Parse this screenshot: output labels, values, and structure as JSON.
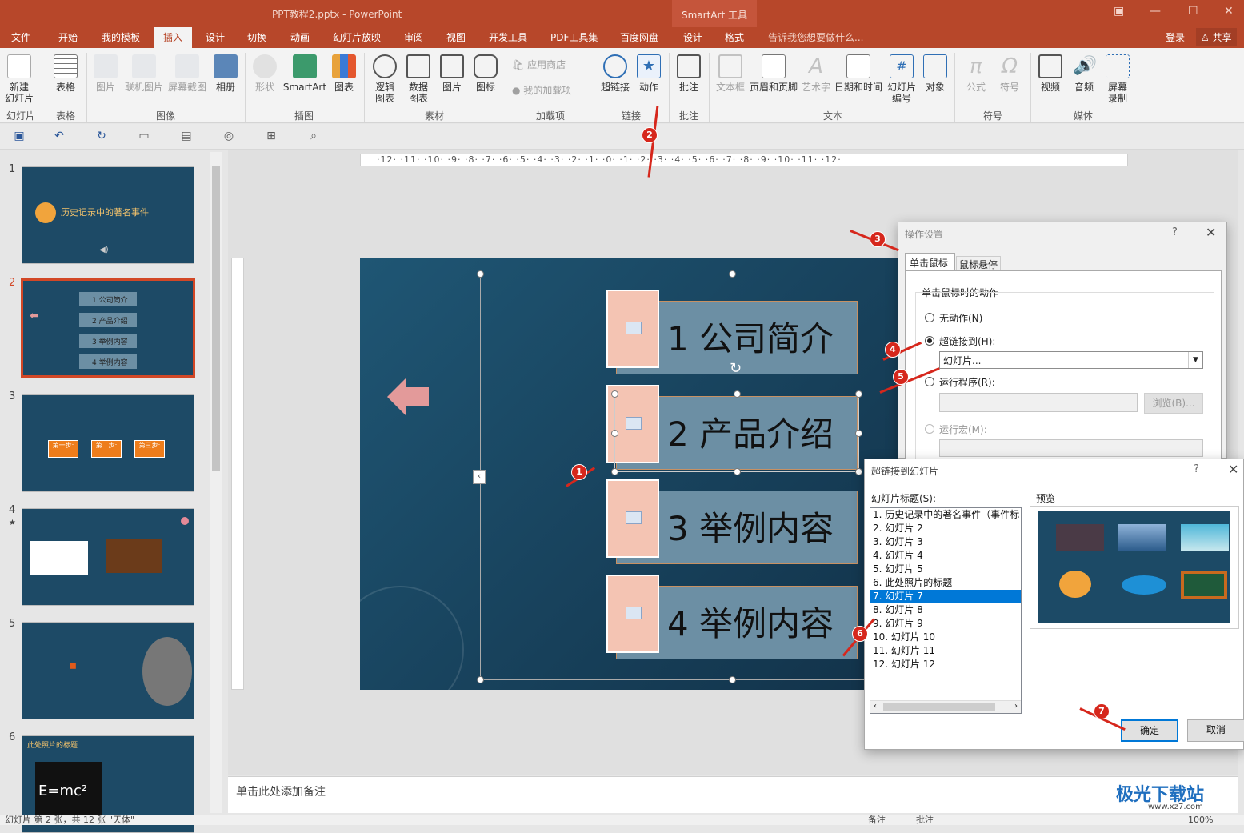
{
  "window": {
    "title": "PPT教程2.pptx - PowerPoint",
    "context_tab": "SmartArt 工具"
  },
  "tabs": [
    "文件",
    "开始",
    "我的模板",
    "插入",
    "设计",
    "切换",
    "动画",
    "幻灯片放映",
    "审阅",
    "视图",
    "开发工具",
    "PDF工具集",
    "百度网盘",
    "设计",
    "格式"
  ],
  "tell_me": "告诉我您想要做什么...",
  "login": "登录",
  "share": "共享",
  "ribbon": {
    "new_slide": "新建\n幻灯片",
    "table": "表格",
    "picture": "图片",
    "online_picture": "联机图片",
    "screenshot": "屏幕截图",
    "album": "相册",
    "shapes": "形状",
    "smartart": "SmartArt",
    "chart": "图表",
    "logic_chart": "逻辑\n图表",
    "data_chart": "数据\n图表",
    "pic2": "图片",
    "icon": "图标",
    "app_store": "应用商店",
    "my_addins": "我的加载项",
    "hyperlink": "超链接",
    "action": "动作",
    "comment": "批注",
    "textbox": "文本框",
    "header_footer": "页眉和页脚",
    "wordart": "艺术字",
    "datetime": "日期和时间",
    "slide_number": "幻灯片\n编号",
    "object": "对象",
    "equation": "公式",
    "symbol": "符号",
    "video": "视频",
    "audio": "音频",
    "screen_record": "屏幕\n录制"
  },
  "groups": {
    "slides": "幻灯片",
    "tables": "表格",
    "images": "图像",
    "illustrations": "插图",
    "materials": "素材",
    "addins": "加载项",
    "links": "链接",
    "comments": "批注",
    "text": "文本",
    "symbols": "符号",
    "media": "媒体"
  },
  "thumbs": {
    "s1_title": "历史记录中的著名事件",
    "s2_items": [
      "1 公司简介",
      "2 产品介绍",
      "3 举例内容",
      "4 举例内容"
    ],
    "s3_steps": [
      "第一步:",
      "第二步:",
      "第三步:"
    ],
    "s6_title": "此处照片的标题",
    "formula": "E=mc²"
  },
  "slide_items": [
    "1 公司简介",
    "2 产品介绍",
    "3 举例内容",
    "4 举例内容"
  ],
  "ruler": "·12· ·11· ·10· ·9· ·8· ·7· ·6· ·5· ·4· ·3· ·2· ·1· ·0· ·1· ·2· ·3· ·4· ·5· ·6· ·7· ·8· ·9· ·10· ·11· ·12·",
  "notes_placeholder": "单击此处添加备注",
  "status": {
    "left": "幻灯片 第 2 张，共 12 张   \"天体\"",
    "notes": "备注",
    "comments": "批注",
    "zoom": "100%"
  },
  "action_dialog": {
    "title": "操作设置",
    "tab_click": "单击鼠标",
    "tab_hover": "鼠标悬停",
    "section": "单击鼠标时的动作",
    "no_action": "无动作(N)",
    "hyperlink_to": "超链接到(H):",
    "hyperlink_value": "幻灯片...",
    "run_program": "运行程序(R):",
    "browse": "浏览(B)...",
    "run_macro": "运行宏(M):"
  },
  "slide_dialog": {
    "title": "超链接到幻灯片",
    "list_label": "幻灯片标题(S):",
    "preview_label": "预览",
    "items": [
      "1. 历史记录中的著名事件（事件标",
      "2. 幻灯片 2",
      "3. 幻灯片 3",
      "4. 幻灯片 4",
      "5. 幻灯片 5",
      "6. 此处照片的标题",
      "7. 幻灯片 7",
      "8. 幻灯片 8",
      "9. 幻灯片 9",
      "10. 幻灯片 10",
      "11. 幻灯片 11",
      "12. 幻灯片 12"
    ],
    "selected_index": 6,
    "ok": "确定",
    "cancel": "取消"
  },
  "markers": [
    "1",
    "2",
    "3",
    "4",
    "5",
    "6",
    "7"
  ],
  "watermark": {
    "brand": "极光下载站",
    "url": "www.xz7.com"
  },
  "colors": {
    "accent": "#b7472a",
    "selection": "#0078d7",
    "marker": "#d6271c"
  }
}
